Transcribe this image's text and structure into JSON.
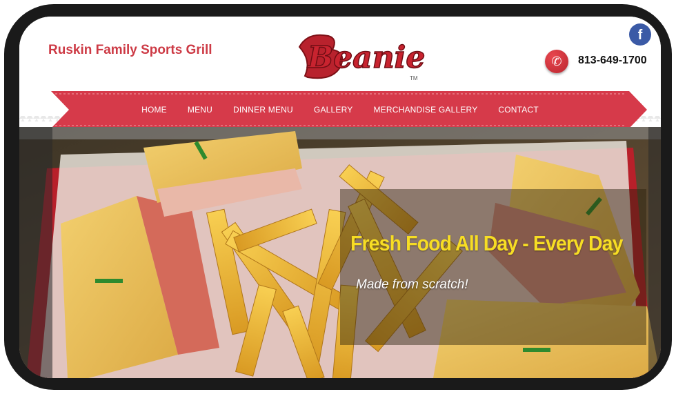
{
  "header": {
    "site_title": "Ruskin Family Sports Grill",
    "logo_text": "Beanie's",
    "logo_tm": "TM",
    "phone": "813-649-1700",
    "facebook_glyph": "f"
  },
  "nav": {
    "items": [
      {
        "label": "HOME"
      },
      {
        "label": "MENU"
      },
      {
        "label": "DINNER MENU"
      },
      {
        "label": "GALLERY"
      },
      {
        "label": "MERCHANDISE GALLERY"
      },
      {
        "label": "CONTACT"
      }
    ]
  },
  "hero": {
    "title": "Fresh Food All Day - Every Day",
    "subtitle": "Made from scratch!"
  },
  "colors": {
    "brand_red": "#cd3a45",
    "ribbon_red": "#d63a4a",
    "caption_yellow": "#f7dd24",
    "frame": "#1a1a1a"
  },
  "icons": {
    "phone": "phone-icon",
    "facebook": "facebook-icon"
  }
}
